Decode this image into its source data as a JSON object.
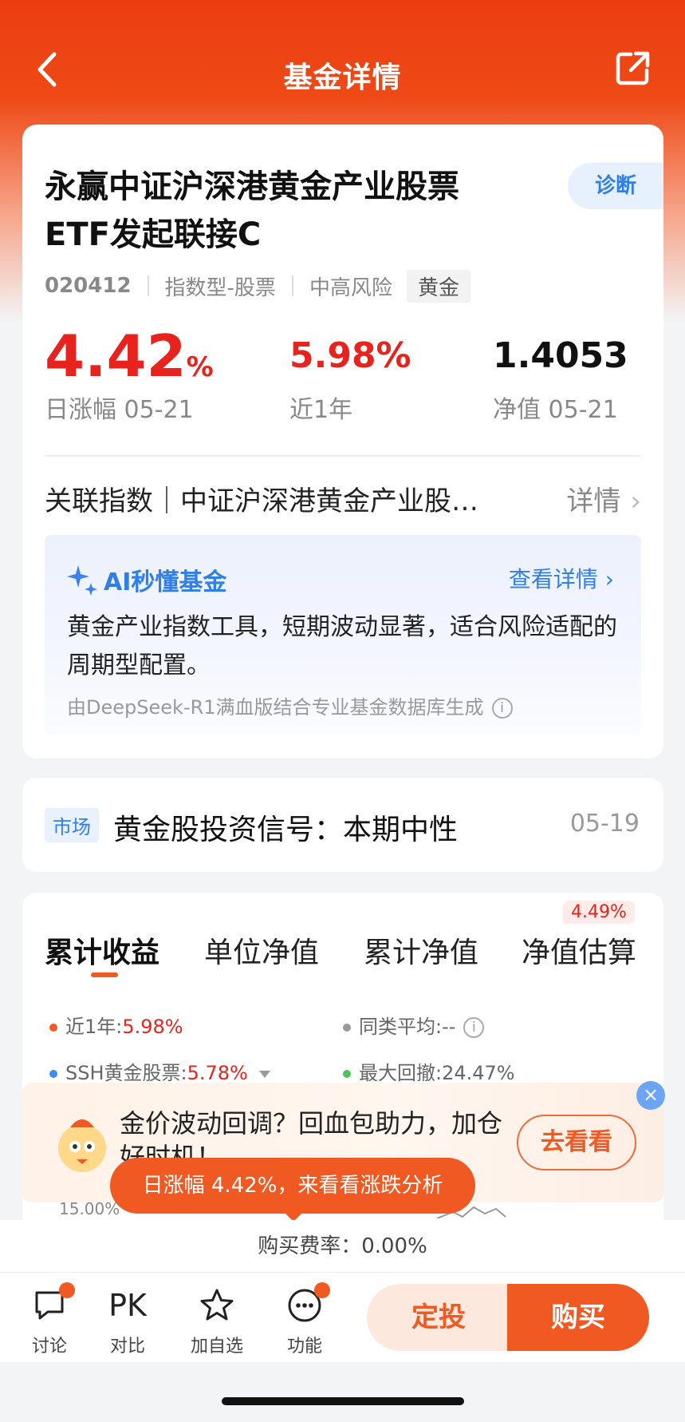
{
  "header": {
    "title": "基金详情",
    "back_icon": "chevron-left-icon",
    "share_icon": "share-icon"
  },
  "fund": {
    "name_line1": "永赢中证沪深港黄金产业股票",
    "name_line2": "ETF发起联接C",
    "diagnose_label": "诊断",
    "code": "020412",
    "type": "指数型-股票",
    "risk": "中高风险",
    "theme_tag": "黄金"
  },
  "metrics": {
    "daily_change_value": "4.42",
    "daily_change_unit": "%",
    "daily_change_label": "日涨幅 05-21",
    "one_year_value": "5.98%",
    "one_year_label": "近1年",
    "nav_value": "1.4053",
    "nav_label": "净值 05-21"
  },
  "index": {
    "text": "关联指数｜中证沪深港黄金产业股票指数",
    "detail_label": "详情"
  },
  "ai": {
    "title": "AI秒懂基金",
    "more_label": "查看详情",
    "body": "黄金产业指数工具，短期波动显著，适合风险适配的周期型配置。",
    "source": "由DeepSeek-R1满血版结合专业基金数据库生成"
  },
  "signal": {
    "tag": "市场",
    "text": "黄金股投资信号：本期中性",
    "date": "05-19"
  },
  "chart_tabs": {
    "tabs": [
      "累计收益",
      "单位净值",
      "累计净值",
      "净值估算"
    ],
    "estimate_badge": "4.49%"
  },
  "legend": {
    "one_year_label": "近1年:",
    "one_year_value": "5.98%",
    "peer_avg_label": "同类平均:",
    "peer_avg_value": "--",
    "index_label": "SSH黄金股票:",
    "index_value": "5.78%",
    "max_drawdown_label": "最大回撤:",
    "max_drawdown_value": "24.47%",
    "colors": {
      "fund": "#f05a22",
      "peer": "#999999",
      "index": "#3b8ef0",
      "drawdown": "#4cc65c"
    }
  },
  "promo": {
    "text": "金价波动回调？回血包助力，加仓好时机！",
    "button": "去看看"
  },
  "chart_axis_label": "15.00%",
  "tooltip": "日涨幅 4.42%，来看看涨跌分析",
  "fee": "购买费率：0.00%",
  "bottom_bar": {
    "discuss": "讨论",
    "compare_icon_text": "PK",
    "compare": "对比",
    "watchlist": "加自选",
    "functions": "功能",
    "dingtou": "定投",
    "buy": "购买"
  },
  "accent_color": "#f05a22"
}
